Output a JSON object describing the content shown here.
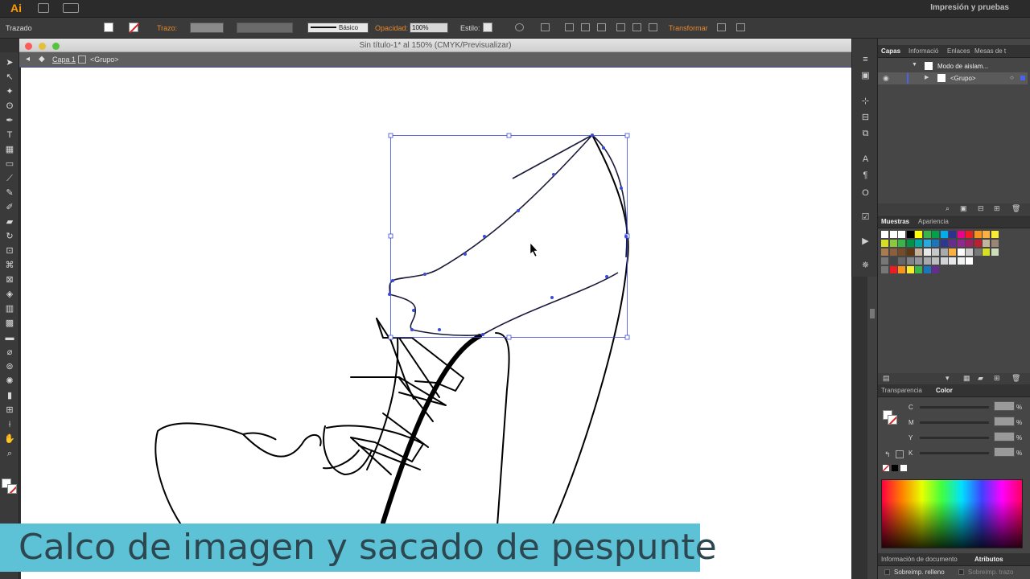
{
  "app": {
    "logo": "Ai",
    "workspace": "Impresión y pruebas"
  },
  "control_bar": {
    "selection_type": "Trazado",
    "stroke_label": "Trazo:",
    "brush_label": "Básico",
    "opacity_label": "Opacidad:",
    "opacity_value": "100%",
    "style_label": "Estilo:",
    "transform_label": "Transformar"
  },
  "document": {
    "title": "Sin título-1* al 150% (CMYK/Previsualizar)",
    "breadcrumb_layer": "Capa 1",
    "breadcrumb_group": "<Grupo>"
  },
  "caption": {
    "text": "Calco de imagen y sacado de pespunte"
  },
  "layers_panel": {
    "tabs": [
      "Capas",
      "Informació",
      "Enlaces",
      "Mesas de t"
    ],
    "rows": [
      {
        "label": "Modo de aislam..."
      },
      {
        "label": "<Grupo>"
      }
    ]
  },
  "swatches_panel": {
    "tabs": [
      "Muestras",
      "Apariencia"
    ]
  },
  "color_panel": {
    "tabs": [
      "Transparencia",
      "Color"
    ],
    "channels": [
      {
        "label": "C",
        "unit": "%"
      },
      {
        "label": "M",
        "unit": "%"
      },
      {
        "label": "Y",
        "unit": "%"
      },
      {
        "label": "K",
        "unit": "%"
      }
    ]
  },
  "bottom_panel": {
    "tabs": [
      "Información de documento",
      "Atributos"
    ],
    "overprint_fill": "Sobreimp. relleno",
    "overprint_stroke": "Sobreimp. trazo"
  },
  "colors": {
    "accent": "#ff9a00",
    "caption_bg": "#5ec2d6",
    "caption_text": "#2d4750",
    "selection": "#3c4bd6",
    "label_orange": "#e8872c"
  }
}
